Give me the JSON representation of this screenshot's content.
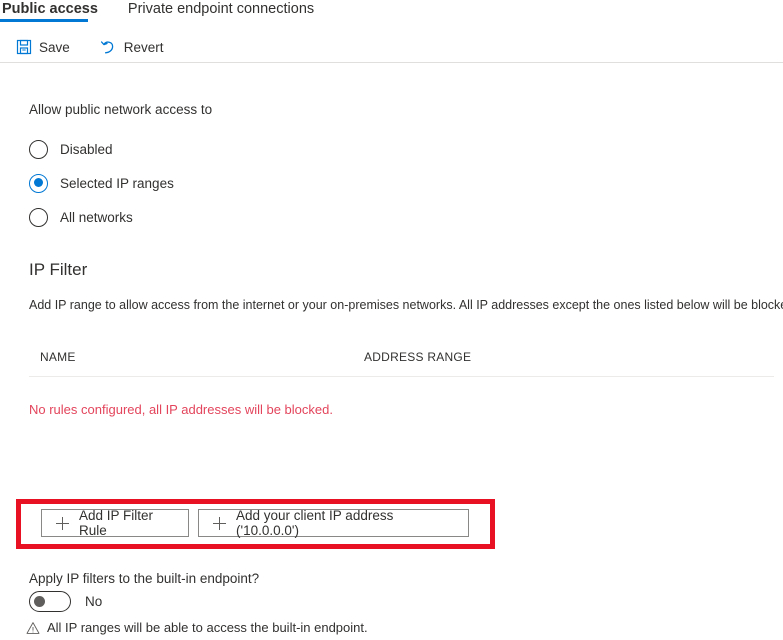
{
  "tabs": [
    {
      "label": "Public access",
      "active": true
    },
    {
      "label": "Private endpoint connections",
      "active": false
    }
  ],
  "toolbar": {
    "save_label": "Save",
    "save_icon": "save-floppy-icon",
    "revert_label": "Revert",
    "revert_icon": "undo-arrow-icon"
  },
  "access": {
    "field_label": "Allow public network access to",
    "options": [
      {
        "label": "Disabled",
        "selected": false
      },
      {
        "label": "Selected IP ranges",
        "selected": true
      },
      {
        "label": "All networks",
        "selected": false
      }
    ]
  },
  "ip_filter": {
    "title": "IP Filter",
    "description": "Add IP range to allow access from the internet or your on-premises networks. All IP addresses except the ones listed below will be blocked.",
    "columns": [
      "NAME",
      "ADDRESS RANGE"
    ],
    "rows": [],
    "empty_message": "No rules configured, all IP addresses will be blocked.",
    "add_rule_label": "Add IP Filter Rule",
    "add_client_ip_label": "Add your client IP address ('10.0.0.0')"
  },
  "builtin_endpoint": {
    "question": "Apply IP filters to the built-in endpoint?",
    "toggle_value": "No",
    "toggle_on": false,
    "warning": "All IP ranges will be able to access the built-in endpoint.",
    "warning_icon": "warning-triangle-icon"
  },
  "colors": {
    "accent": "#0078d4",
    "error_text": "#e3455c",
    "highlight_box": "#e81123",
    "text": "#323130",
    "border": "#8a8886"
  }
}
